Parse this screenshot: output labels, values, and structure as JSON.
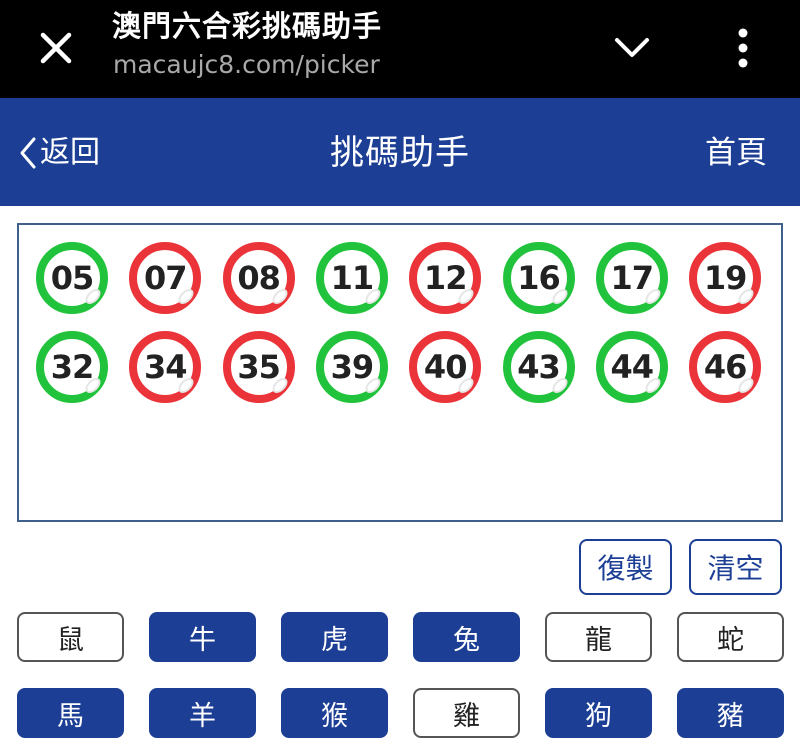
{
  "browser": {
    "title": "澳門六合彩挑碼助手",
    "url": "macaujc8.com/picker",
    "icons": {
      "close": "close-icon",
      "collapse": "chevron-down-icon",
      "menu": "more-vertical-icon"
    }
  },
  "header": {
    "back_label": "返回",
    "title": "挑碼助手",
    "home_label": "首頁"
  },
  "colors": {
    "brand": "#1c3f95",
    "ball_green": "#22c33c",
    "ball_red": "#ea3439"
  },
  "numbers": [
    {
      "value": "05",
      "color": "green"
    },
    {
      "value": "07",
      "color": "red"
    },
    {
      "value": "08",
      "color": "red"
    },
    {
      "value": "11",
      "color": "green"
    },
    {
      "value": "12",
      "color": "red"
    },
    {
      "value": "16",
      "color": "green"
    },
    {
      "value": "17",
      "color": "green"
    },
    {
      "value": "19",
      "color": "red"
    },
    {
      "value": "32",
      "color": "green"
    },
    {
      "value": "34",
      "color": "red"
    },
    {
      "value": "35",
      "color": "red"
    },
    {
      "value": "39",
      "color": "green"
    },
    {
      "value": "40",
      "color": "red"
    },
    {
      "value": "43",
      "color": "green"
    },
    {
      "value": "44",
      "color": "green"
    },
    {
      "value": "46",
      "color": "red"
    }
  ],
  "actions": {
    "copy_label": "復製",
    "clear_label": "清空"
  },
  "zodiac": [
    {
      "label": "鼠",
      "selected": false
    },
    {
      "label": "牛",
      "selected": true
    },
    {
      "label": "虎",
      "selected": true
    },
    {
      "label": "兔",
      "selected": true
    },
    {
      "label": "龍",
      "selected": false
    },
    {
      "label": "蛇",
      "selected": false
    },
    {
      "label": "馬",
      "selected": true
    },
    {
      "label": "羊",
      "selected": true
    },
    {
      "label": "猴",
      "selected": true
    },
    {
      "label": "雞",
      "selected": false
    },
    {
      "label": "狗",
      "selected": true
    },
    {
      "label": "豬",
      "selected": true
    }
  ]
}
